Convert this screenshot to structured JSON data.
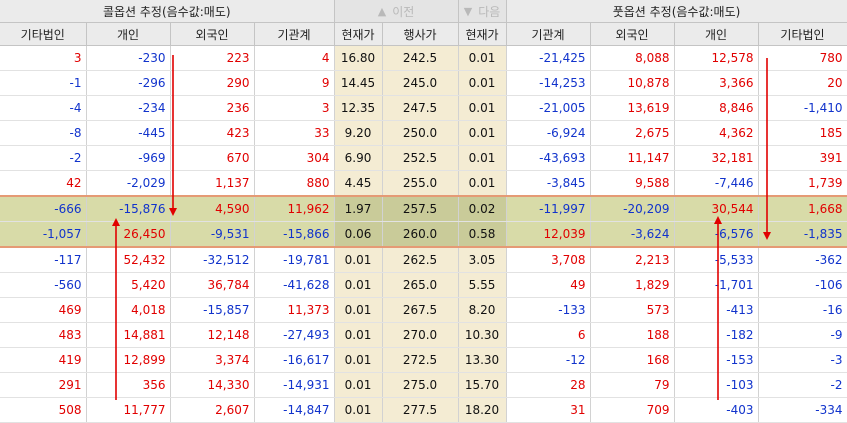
{
  "header": {
    "call_title": "콜옵션 추정(음수값:매도)",
    "put_title": "풋옵션 추정(음수값:매도)",
    "prev_label": "이전",
    "next_label": "다음",
    "columns": [
      "기타법인",
      "개인",
      "외국인",
      "기관계",
      "현재가",
      "행사가",
      "현재가",
      "기관계",
      "외국인",
      "개인",
      "기타법인"
    ]
  },
  "colors": {
    "positive": "#e10000",
    "negative": "#1133cc",
    "strike_bg": "#f4ecd3",
    "highlight_bg": "#d8dba8",
    "highlight_border": "#e59a75",
    "arrow": "#e10000"
  },
  "rows": [
    [
      "3",
      "-230",
      "223",
      "4",
      "16.80",
      "242.5",
      "0.01",
      "-21,425",
      "8,088",
      "12,578",
      "780"
    ],
    [
      "-1",
      "-296",
      "290",
      "9",
      "14.45",
      "245.0",
      "0.01",
      "-14,253",
      "10,878",
      "3,366",
      "20"
    ],
    [
      "-4",
      "-234",
      "236",
      "3",
      "12.35",
      "247.5",
      "0.01",
      "-21,005",
      "13,619",
      "8,846",
      "-1,410"
    ],
    [
      "-8",
      "-445",
      "423",
      "33",
      "9.20",
      "250.0",
      "0.01",
      "-6,924",
      "2,675",
      "4,362",
      "185"
    ],
    [
      "-2",
      "-969",
      "670",
      "304",
      "6.90",
      "252.5",
      "0.01",
      "-43,693",
      "11,147",
      "32,181",
      "391"
    ],
    [
      "42",
      "-2,029",
      "1,137",
      "880",
      "4.45",
      "255.0",
      "0.01",
      "-3,845",
      "9,588",
      "-7,446",
      "1,739"
    ],
    [
      "-666",
      "-15,876",
      "4,590",
      "11,962",
      "1.97",
      "257.5",
      "0.02",
      "-11,997",
      "-20,209",
      "30,544",
      "1,668"
    ],
    [
      "-1,057",
      "26,450",
      "-9,531",
      "-15,866",
      "0.06",
      "260.0",
      "0.58",
      "12,039",
      "-3,624",
      "-6,576",
      "-1,835"
    ],
    [
      "-117",
      "52,432",
      "-32,512",
      "-19,781",
      "0.01",
      "262.5",
      "3.05",
      "3,708",
      "2,213",
      "-5,533",
      "-362"
    ],
    [
      "-560",
      "5,420",
      "36,784",
      "-41,628",
      "0.01",
      "265.0",
      "5.55",
      "49",
      "1,829",
      "-1,701",
      "-106"
    ],
    [
      "469",
      "4,018",
      "-15,857",
      "11,373",
      "0.01",
      "267.5",
      "8.20",
      "-133",
      "573",
      "-413",
      "-16"
    ],
    [
      "483",
      "14,881",
      "12,148",
      "-27,493",
      "0.01",
      "270.0",
      "10.30",
      "6",
      "188",
      "-182",
      "-9"
    ],
    [
      "419",
      "12,899",
      "3,374",
      "-16,617",
      "0.01",
      "272.5",
      "13.30",
      "-12",
      "168",
      "-153",
      "-3"
    ],
    [
      "291",
      "356",
      "14,330",
      "-14,931",
      "0.01",
      "275.0",
      "15.70",
      "28",
      "79",
      "-103",
      "-2"
    ],
    [
      "508",
      "11,777",
      "2,607",
      "-14,847",
      "0.01",
      "277.5",
      "18.20",
      "31",
      "709",
      "-403",
      "-334"
    ]
  ]
}
